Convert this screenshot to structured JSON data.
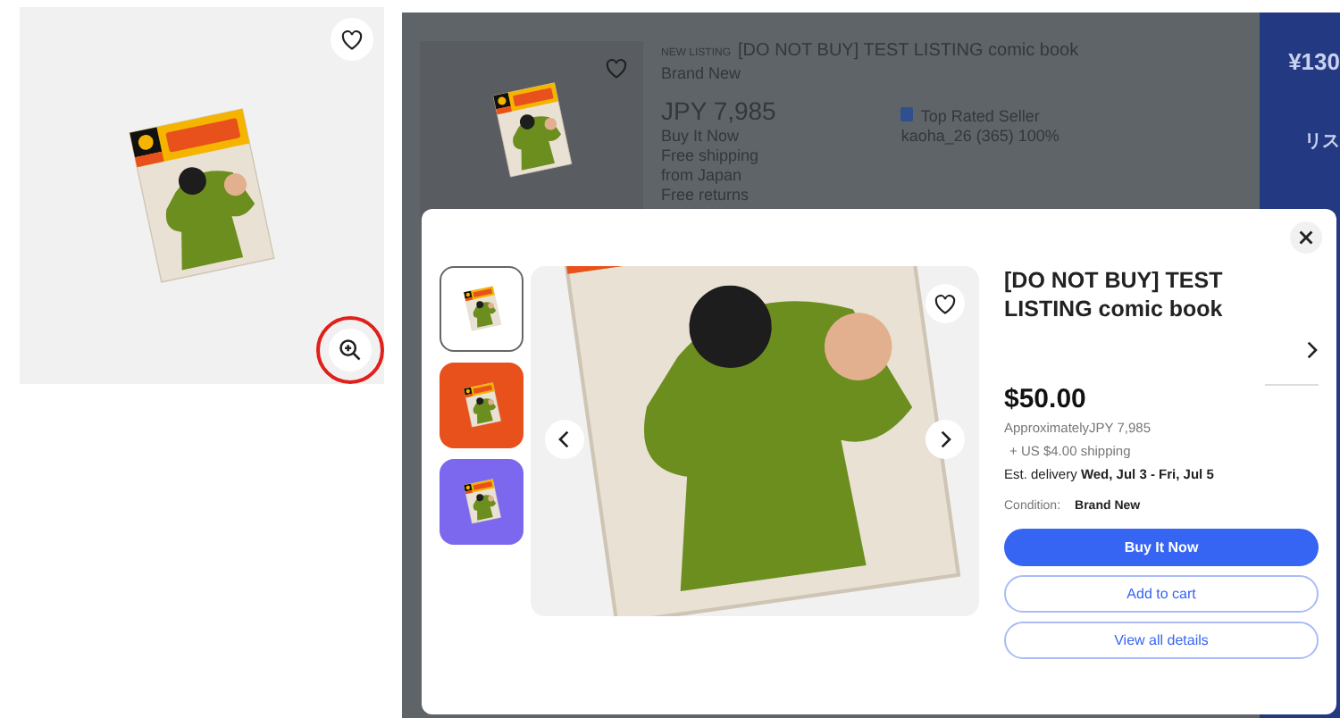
{
  "product_image": {
    "favorite": false,
    "zoom_button": {
      "highlighted": true
    }
  },
  "background_listing": {
    "badge": "NEW LISTING",
    "title": "[DO NOT BUY] TEST LISTING comic book",
    "condition": "Brand New",
    "price": "JPY 7,985",
    "format": "Buy It Now",
    "details": [
      "Free shipping",
      "from Japan",
      "Free returns"
    ],
    "seller_badge": "Top Rated Seller",
    "seller": "kaoha_26 (365) 100%",
    "favorite": false
  },
  "side_panel": {
    "price": "¥130",
    "label": "リス"
  },
  "modal": {
    "thumbnails": [
      {
        "color": "#ffffff",
        "selected": true
      },
      {
        "color": "#e8501c",
        "selected": false
      },
      {
        "color": "#7b68ee",
        "selected": false
      }
    ],
    "favorite": false,
    "title": "[DO NOT BUY] TEST LISTING comic book",
    "price": "$50.00",
    "approximate": "ApproximatelyJPY 7,985",
    "shipping": "+ US $4.00 shipping",
    "delivery": "Est. delivery **Wed, Jul 3 - Fri, Jul 5**",
    "condition_label": "Condition:",
    "condition": "Brand New",
    "buttons": [
      {
        "label": "Buy It Now",
        "kind": "primary"
      },
      {
        "label": "Add to cart",
        "kind": "secondary"
      },
      {
        "label": "View all details",
        "kind": "secondary"
      }
    ]
  }
}
